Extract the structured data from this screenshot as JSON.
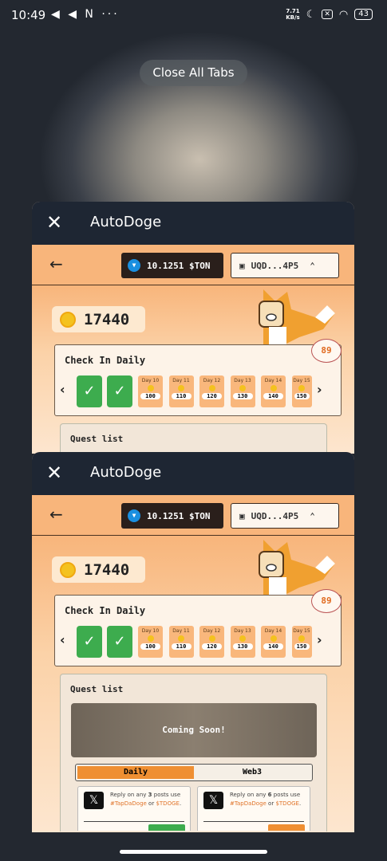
{
  "status_bar": {
    "time": "10:49",
    "notif_icons": "◀ ◀ N ···",
    "speed_value": "7.71",
    "speed_unit": "KB/s",
    "battery": "43"
  },
  "close_all_label": "Close All Tabs",
  "tab": {
    "app_title": "AutoDoge",
    "close_icon": "✕",
    "back_icon": "←",
    "ton_balance": "10.1251 $TON",
    "wallet_address": "UQD...4P5",
    "coin_balance": "17440",
    "checkin": {
      "title": "Check In Daily",
      "badge": "89",
      "checked": [
        "✓",
        "✓"
      ],
      "days": [
        {
          "label": "Day 10",
          "reward": "100"
        },
        {
          "label": "Day 11",
          "reward": "110"
        },
        {
          "label": "Day 12",
          "reward": "120"
        },
        {
          "label": "Day 13",
          "reward": "130"
        },
        {
          "label": "Day 14",
          "reward": "140"
        },
        {
          "label": "Day 15",
          "reward": "150"
        }
      ]
    },
    "quest": {
      "title": "Quest list",
      "banner": "Coming Soon!",
      "tabs": [
        "Daily",
        "Web3"
      ],
      "cards": [
        {
          "pre": "Reply on any ",
          "count": "3",
          "post": " posts use ",
          "tag1": "#TapDaDoge",
          "or": " or ",
          "tag2": "$TDOGE",
          "end": ".",
          "button_color": "#3dac4e"
        },
        {
          "pre": "Reply on any ",
          "count": "6",
          "post": " posts use ",
          "tag1": "#TapDaDoge",
          "or": " or ",
          "tag2": "$TDOGE",
          "end": ".",
          "button_color": "#ef8f32"
        }
      ]
    }
  },
  "colors": {
    "header": "#1e2633",
    "nav": "#f8b57b",
    "accent": "#ef8f32",
    "check": "#3dac4e"
  }
}
